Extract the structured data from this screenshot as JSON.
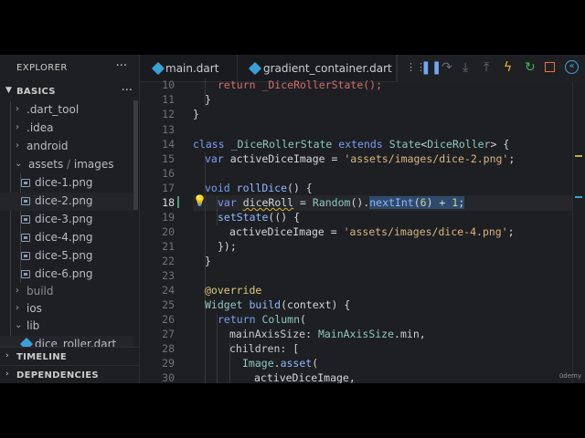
{
  "sidebar": {
    "title": "EXPLORER",
    "more": "···",
    "section": "BASICS",
    "items": [
      {
        "label": ".dart_tool",
        "kind": "folder",
        "open": false
      },
      {
        "label": ".idea",
        "kind": "folder",
        "open": false
      },
      {
        "label": "android",
        "kind": "folder",
        "open": false
      },
      {
        "label": "assets",
        "kind": "folder",
        "open": true
      },
      {
        "label": "dice-1.png",
        "kind": "image"
      },
      {
        "label": "dice-2.png",
        "kind": "image"
      },
      {
        "label": "dice-3.png",
        "kind": "image"
      },
      {
        "label": "dice-4.png",
        "kind": "image"
      },
      {
        "label": "dice-5.png",
        "kind": "image"
      },
      {
        "label": "dice-6.png",
        "kind": "image"
      },
      {
        "label": "build",
        "kind": "folder",
        "open": false
      },
      {
        "label": "ios",
        "kind": "folder",
        "open": false
      },
      {
        "label": "lib",
        "kind": "folder",
        "open": true
      },
      {
        "label": "dice_roller.dart",
        "kind": "dart"
      }
    ],
    "assets_sep": "/",
    "assets_sub": "images",
    "timeline": "TIMELINE",
    "dependencies": "DEPENDENCIES"
  },
  "tabs": [
    {
      "label": "main.dart"
    },
    {
      "label": "gradient_container.dart"
    }
  ],
  "debug_icons": [
    "drag-handle-icon",
    "pause-icon",
    "step-over-icon",
    "step-into-icon",
    "step-out-icon",
    "hot-reload-icon",
    "restart-icon",
    "stop-icon",
    "devtools-icon"
  ],
  "colors": {
    "accent": "#3aa0d8",
    "reload": "#f0b429",
    "restart": "#3fb950",
    "stop": "#f06a4a"
  },
  "line_numbers": [
    "10",
    "11",
    "12",
    "13",
    "14",
    "15",
    "16",
    "17",
    "18",
    "19",
    "20",
    "21",
    "22",
    "23",
    "24",
    "25",
    "26",
    "27",
    "28",
    "29",
    "30"
  ],
  "current_line": "18",
  "code": {
    "l10": "return _DiceRollerState();",
    "l11": "}",
    "l12": "}",
    "l14": [
      "class",
      " ",
      "_DiceRollerState",
      " ",
      "extends",
      " ",
      "State",
      "<",
      "DiceRoller",
      "> {"
    ],
    "l15": [
      "var",
      " activeDiceImage = ",
      "'assets/images/dice-2.png'",
      ";"
    ],
    "l17": [
      "void",
      " ",
      "rollDice",
      "() {"
    ],
    "l18": [
      "var",
      " ",
      "diceRoll",
      " = ",
      "Random",
      "().",
      "nextInt",
      "(",
      "6",
      ") + ",
      "1",
      ";"
    ],
    "l19": [
      "setState",
      "(() {"
    ],
    "l20": [
      "activeDiceImage = ",
      "'assets/images/dice-4.png'",
      ";"
    ],
    "l21": "});",
    "l22": "}",
    "l24": "@override",
    "l25": [
      "Widget",
      " ",
      "build",
      "(context) {"
    ],
    "l26": [
      "return",
      " ",
      "Column",
      "("
    ],
    "l27": [
      "mainAxisSize: ",
      "MainAxisSize",
      ".",
      "min",
      ","
    ],
    "l28": [
      "children: ["
    ],
    "l29": [
      "Image",
      ".",
      "asset",
      "("
    ],
    "l30": [
      "activeDiceImage,"
    ]
  },
  "watermark": "ūdemy"
}
